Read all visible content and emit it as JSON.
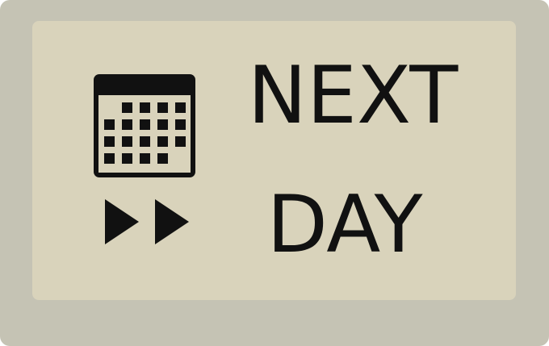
{
  "key": {
    "label_line1": "NEXT",
    "label_line2": "DAY",
    "icons": [
      "calendar-icon",
      "fast-forward-icon"
    ],
    "colors": {
      "outer": "#c5c3b4",
      "face": "#d9d3bb",
      "ink": "#111111"
    }
  }
}
